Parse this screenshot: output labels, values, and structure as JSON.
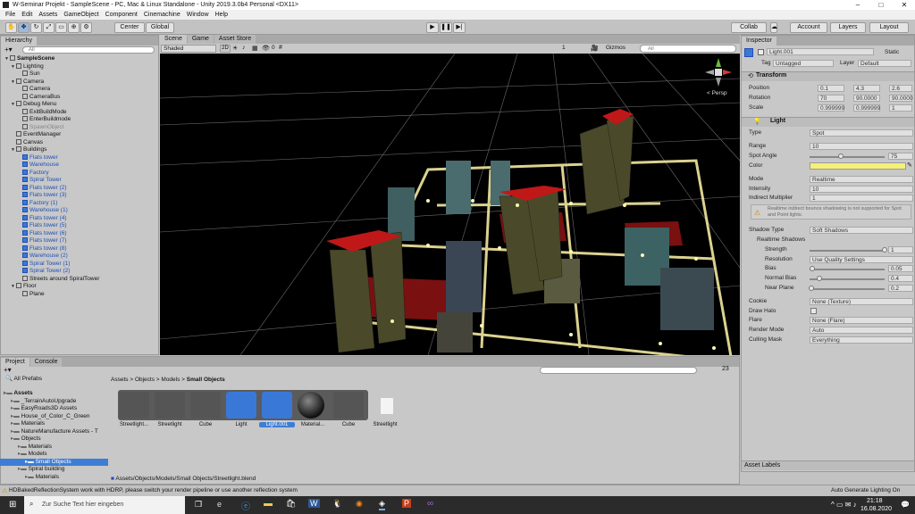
{
  "window": {
    "title": "W-Seminar Projekt - SampleScene - PC, Mac & Linux Standalone - Unity 2019.3.0b4 Personal <DX11>"
  },
  "menu": [
    "File",
    "Edit",
    "Assets",
    "GameObject",
    "Component",
    "Cinemachine",
    "Window",
    "Help"
  ],
  "toolbar": {
    "center": "Center",
    "global": "Global",
    "collab": "Collab",
    "account": "Account",
    "layers": "Layers",
    "layout": "Layout"
  },
  "hierarchy": {
    "tab": "Hierarchy",
    "search_placeholder": "All",
    "rows": [
      {
        "label": "SampleScene",
        "indent": 0,
        "style": "scene"
      },
      {
        "label": "Lighting",
        "indent": 1,
        "style": "normal"
      },
      {
        "label": "Sun",
        "indent": 2,
        "style": "normal"
      },
      {
        "label": "Camera",
        "indent": 1,
        "style": "normal"
      },
      {
        "label": "Camera",
        "indent": 2,
        "style": "normal"
      },
      {
        "label": "CameraBus",
        "indent": 2,
        "style": "normal"
      },
      {
        "label": "Debug Menu",
        "indent": 1,
        "style": "normal"
      },
      {
        "label": "ExitBuildMode",
        "indent": 2,
        "style": "normal"
      },
      {
        "label": "EnterBuildmode",
        "indent": 2,
        "style": "normal"
      },
      {
        "label": "SpawnObject",
        "indent": 2,
        "style": "grey"
      },
      {
        "label": "EventManager",
        "indent": 1,
        "style": "normal"
      },
      {
        "label": "Canvas",
        "indent": 1,
        "style": "normal"
      },
      {
        "label": "Buildings",
        "indent": 1,
        "style": "normal"
      },
      {
        "label": "Flats tower",
        "indent": 2,
        "style": "blue"
      },
      {
        "label": "Warehouse",
        "indent": 2,
        "style": "blue"
      },
      {
        "label": "Factory",
        "indent": 2,
        "style": "blue"
      },
      {
        "label": "Spiral Tower",
        "indent": 2,
        "style": "blue"
      },
      {
        "label": "Flats tower (2)",
        "indent": 2,
        "style": "blue"
      },
      {
        "label": "Flats tower (3)",
        "indent": 2,
        "style": "blue"
      },
      {
        "label": "Factory (1)",
        "indent": 2,
        "style": "blue"
      },
      {
        "label": "Warehouse (1)",
        "indent": 2,
        "style": "blue"
      },
      {
        "label": "Flats tower (4)",
        "indent": 2,
        "style": "blue"
      },
      {
        "label": "Flats tower (5)",
        "indent": 2,
        "style": "blue"
      },
      {
        "label": "Flats tower (6)",
        "indent": 2,
        "style": "blue"
      },
      {
        "label": "Flats tower (7)",
        "indent": 2,
        "style": "blue"
      },
      {
        "label": "Flats tower (8)",
        "indent": 2,
        "style": "blue"
      },
      {
        "label": "Warehouse (2)",
        "indent": 2,
        "style": "blue"
      },
      {
        "label": "Spiral Tower (1)",
        "indent": 2,
        "style": "blue"
      },
      {
        "label": "Spiral Tower (2)",
        "indent": 2,
        "style": "blue"
      },
      {
        "label": "Streets around SpiralTower",
        "indent": 2,
        "style": "normal"
      },
      {
        "label": "Floor",
        "indent": 1,
        "style": "normal"
      },
      {
        "label": "Plane",
        "indent": 2,
        "style": "normal"
      }
    ]
  },
  "scene": {
    "tabs": [
      "Scene",
      "Game",
      "Asset Store"
    ],
    "shading": "Shaded",
    "mode2d": "2D",
    "gizmos": "Gizmos",
    "search_placeholder": "All",
    "persp": "< Persp",
    "layer_count": "1",
    "effects_count": "0"
  },
  "project": {
    "tabs": [
      "Project",
      "Console"
    ],
    "favorites": "All Prefabs",
    "tree": [
      {
        "label": "Assets",
        "indent": 0,
        "bold": true
      },
      {
        "label": "_TerrainAutoUpgrade",
        "indent": 1
      },
      {
        "label": "EasyRoads3D Assets",
        "indent": 1
      },
      {
        "label": "House_of_Color_C_Green",
        "indent": 1
      },
      {
        "label": "Materials",
        "indent": 1
      },
      {
        "label": "NatureManufacture Assets - T",
        "indent": 1
      },
      {
        "label": "Objects",
        "indent": 1
      },
      {
        "label": "Materials",
        "indent": 2
      },
      {
        "label": "Models",
        "indent": 2
      },
      {
        "label": "Small Objects",
        "indent": 3,
        "selected": true
      },
      {
        "label": "Spiral building",
        "indent": 2
      },
      {
        "label": "Materials",
        "indent": 3
      }
    ],
    "breadcrumb": [
      "Assets",
      "Objects",
      "Models",
      "Small Objects"
    ],
    "item_count": "23",
    "assets": [
      {
        "label": "Streetlight...",
        "kind": "model"
      },
      {
        "label": "Streetlight",
        "kind": "model"
      },
      {
        "label": "Cube",
        "kind": "model"
      },
      {
        "label": "Light",
        "kind": "prefab"
      },
      {
        "label": "Light.001",
        "kind": "prefab",
        "selected": true
      },
      {
        "label": "Material...",
        "kind": "material"
      },
      {
        "label": "Cube",
        "kind": "model"
      },
      {
        "label": "Streetlight",
        "kind": "file"
      }
    ],
    "path": "Assets/Objects/Models/Small Objects/Streetlight.blend"
  },
  "inspector": {
    "tab": "Inspector",
    "object_name": "Light.001",
    "static_label": "Static",
    "tag_label": "Tag",
    "tag_value": "Untagged",
    "layer_label": "Layer",
    "layer_value": "Default",
    "transform": {
      "title": "Transform",
      "position": {
        "label": "Position",
        "x": "0.1",
        "y": "4.3",
        "z": "2.6"
      },
      "rotation": {
        "label": "Rotation",
        "x": "70",
        "y": "90.0000",
        "z": "90.0000"
      },
      "scale": {
        "label": "Scale",
        "x": "0.999999",
        "y": "0.999999",
        "z": "1"
      }
    },
    "light": {
      "title": "Light",
      "type_label": "Type",
      "type_value": "Spot",
      "range_label": "Range",
      "range_value": "10",
      "spot_label": "Spot Angle",
      "spot_value": "75",
      "spot_fraction": 0.42,
      "color_label": "Color",
      "color_value": "#f5f07a",
      "mode_label": "Mode",
      "mode_value": "Realtime",
      "intensity_label": "Intensity",
      "intensity_value": "10",
      "indirect_label": "Indirect Multiplier",
      "indirect_value": "1",
      "warning": "Realtime indirect bounce shadowing is not supported for Spot and Point lights.",
      "shadow_type_label": "Shadow Type",
      "shadow_type_value": "Soft Shadows",
      "realtime_shadows": "Realtime Shadows",
      "strength_label": "Strength",
      "strength_value": "1",
      "strength_fraction": 1,
      "resolution_label": "Resolution",
      "resolution_value": "Use Quality Settings",
      "bias_label": "Bias",
      "bias_value": "0.05",
      "bias_fraction": 0.03,
      "normal_bias_label": "Normal Bias",
      "normal_bias_value": "0.4",
      "normal_bias_fraction": 0.13,
      "near_plane_label": "Near Plane",
      "near_plane_value": "0.2",
      "near_plane_fraction": 0.02,
      "cookie_label": "Cookie",
      "cookie_value": "None (Texture)",
      "halo_label": "Draw Halo",
      "flare_label": "Flare",
      "flare_value": "None (Flare)",
      "render_mode_label": "Render Mode",
      "render_mode_value": "Auto",
      "culling_label": "Culling Mask",
      "culling_value": "Everything"
    },
    "asset_labels": "Asset Labels"
  },
  "status": {
    "message": "HDBakedReflectionSystem work with HDRP, please switch your render pipeline or use another reflection system",
    "right": "Auto Generate Lighting On"
  },
  "taskbar": {
    "search_placeholder": "Zur Suche Text hier eingeben",
    "time": "21:18",
    "date": "16.08.2020"
  }
}
